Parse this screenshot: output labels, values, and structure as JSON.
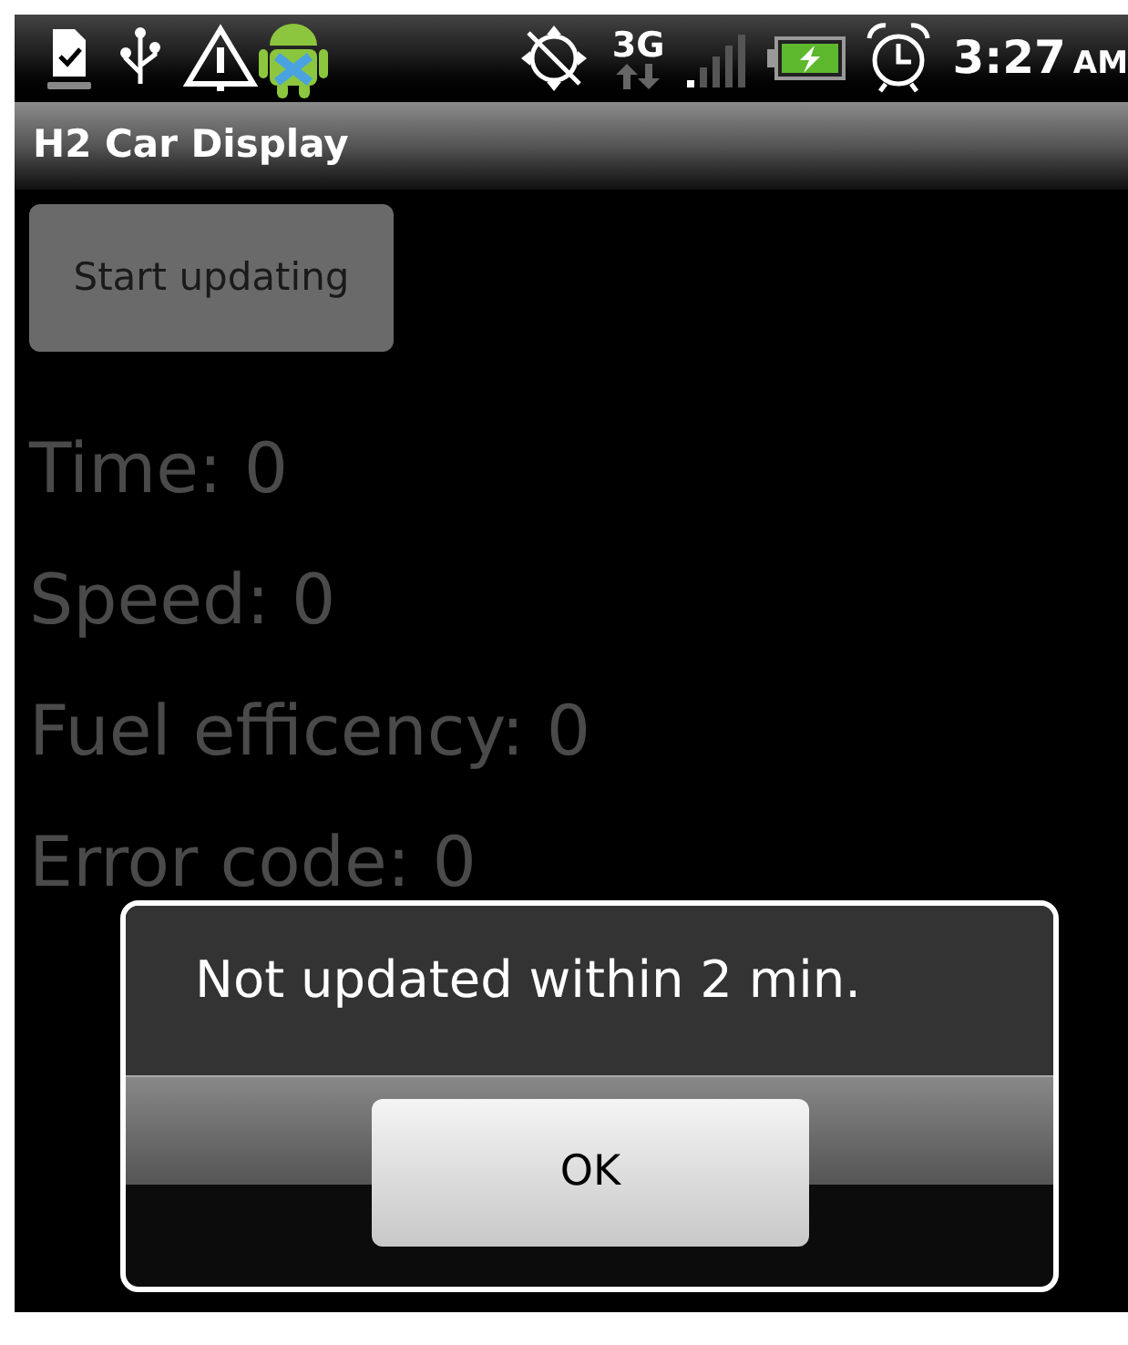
{
  "status_bar": {
    "network": "3G",
    "time": "3:27",
    "meridiem": "AM"
  },
  "title_bar": {
    "title": "H2 Car Display"
  },
  "start_button": {
    "label": "Start updating"
  },
  "readouts": [
    "Time: 0",
    "Speed: 0",
    "Fuel efficency: 0",
    "Error code: 0"
  ],
  "dialog": {
    "message": "Not updated within 2 min.",
    "button": "OK"
  }
}
